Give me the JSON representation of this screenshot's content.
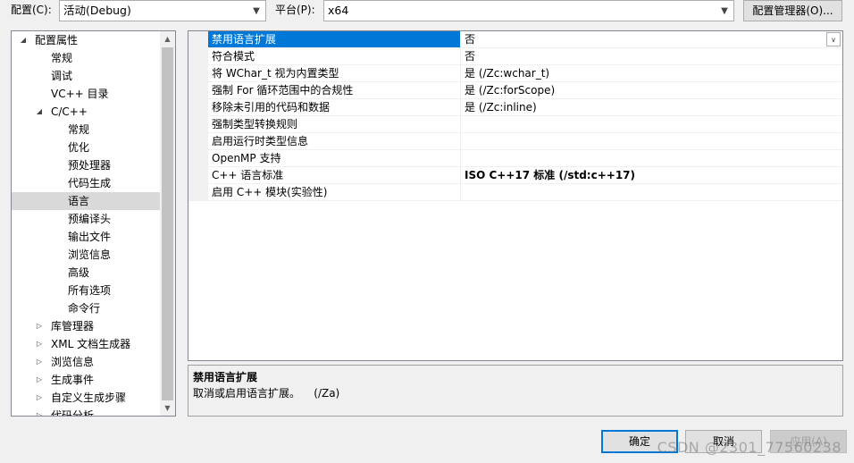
{
  "toolbar": {
    "config_label": "配置(C):",
    "config_value": "活动(Debug)",
    "platform_label": "平台(P):",
    "platform_value": "x64",
    "config_manager_button": "配置管理器(O)..."
  },
  "tree": {
    "items": [
      {
        "label": "配置属性",
        "level": 0,
        "state": "expanded"
      },
      {
        "label": "常规",
        "level": 1
      },
      {
        "label": "调试",
        "level": 1
      },
      {
        "label": "VC++ 目录",
        "level": 1
      },
      {
        "label": "C/C++",
        "level": 1,
        "state": "expanded"
      },
      {
        "label": "常规",
        "level": 2
      },
      {
        "label": "优化",
        "level": 2
      },
      {
        "label": "预处理器",
        "level": 2
      },
      {
        "label": "代码生成",
        "level": 2
      },
      {
        "label": "语言",
        "level": 2,
        "selected": true
      },
      {
        "label": "预编译头",
        "level": 2
      },
      {
        "label": "输出文件",
        "level": 2
      },
      {
        "label": "浏览信息",
        "level": 2
      },
      {
        "label": "高级",
        "level": 2
      },
      {
        "label": "所有选项",
        "level": 2
      },
      {
        "label": "命令行",
        "level": 2
      },
      {
        "label": "库管理器",
        "level": 1,
        "state": "collapsed"
      },
      {
        "label": "XML 文档生成器",
        "level": 1,
        "state": "collapsed"
      },
      {
        "label": "浏览信息",
        "level": 1,
        "state": "collapsed"
      },
      {
        "label": "生成事件",
        "level": 1,
        "state": "collapsed"
      },
      {
        "label": "自定义生成步骤",
        "level": 1,
        "state": "collapsed"
      },
      {
        "label": "代码分析",
        "level": 1,
        "state": "collapsed"
      }
    ]
  },
  "grid": {
    "rows": [
      {
        "name": "禁用语言扩展",
        "value": "否",
        "selected": true
      },
      {
        "name": "符合模式",
        "value": "否"
      },
      {
        "name": "将 WChar_t 视为内置类型",
        "value": "是 (/Zc:wchar_t)"
      },
      {
        "name": "强制 For 循环范围中的合规性",
        "value": "是 (/Zc:forScope)"
      },
      {
        "name": "移除未引用的代码和数据",
        "value": "是 (/Zc:inline)"
      },
      {
        "name": "强制类型转换规则",
        "value": ""
      },
      {
        "name": "启用运行时类型信息",
        "value": ""
      },
      {
        "name": "OpenMP 支持",
        "value": ""
      },
      {
        "name": "C++ 语言标准",
        "value": "ISO C++17 标准 (/std:c++17)",
        "bold": true
      },
      {
        "name": "启用 C++ 模块(实验性)",
        "value": ""
      }
    ]
  },
  "description": {
    "title": "禁用语言扩展",
    "text": "取消或启用语言扩展。    (/Za)"
  },
  "buttons": {
    "ok": "确定",
    "cancel": "取消",
    "apply": "应用(A)"
  },
  "watermark": "CSDN @2301_77560238",
  "colors": {
    "selection": "#0078d7",
    "tree_selection": "#d9d9d9"
  }
}
